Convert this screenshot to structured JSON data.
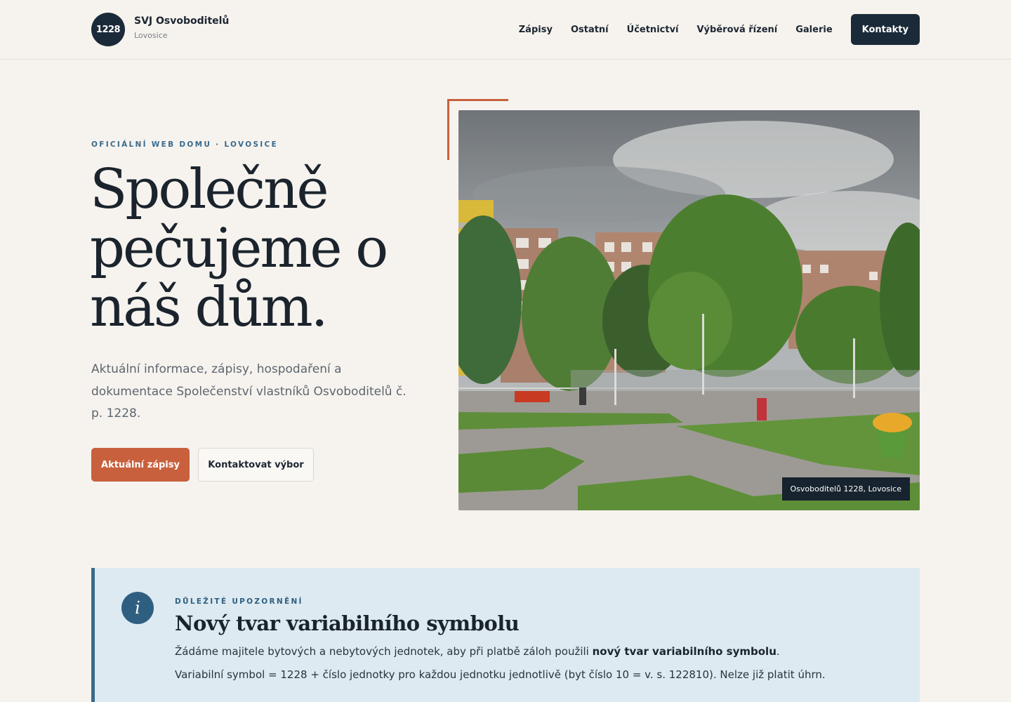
{
  "header": {
    "logo_number": "1228",
    "brand_name": "SVJ Osvoboditelů",
    "brand_sub": "Lovosice",
    "nav": [
      {
        "label": "Zápisy"
      },
      {
        "label": "Ostatní"
      },
      {
        "label": "Účetnictví"
      },
      {
        "label": "Výběrová řízení"
      },
      {
        "label": "Galerie"
      }
    ],
    "cta_label": "Kontakty"
  },
  "hero": {
    "eyebrow": "OFICIÁLNÍ WEB DOMU · LOVOSICE",
    "title": "Společně pečujeme o náš dům.",
    "lead": "Aktuální informace, zápisy, hospodaření a dokumentace Společenství vlastníků Osvoboditelů č. p. 1228.",
    "primary_button": "Aktuální zápisy",
    "secondary_button": "Kontaktovat výbor",
    "photo_caption": "Osvoboditelů 1228, Lovosice"
  },
  "notice": {
    "icon_glyph": "i",
    "eyebrow": "DŮLEŽITÉ UPOZORNĚNÍ",
    "title": "Nový tvar variabilního symbolu",
    "p1_before": "Žádáme majitele bytových a nebytových jednotek, aby při platbě záloh použili ",
    "p1_bold": "nový tvar variabilního symbolu",
    "p1_after": ".",
    "p2": "Variabilní symbol = 1228 + číslo jednotky pro každou jednotku jednotlivě (byt číslo 10 = v. s. 122810). Nelze již platit úhrn."
  },
  "colors": {
    "background": "#f6f3ee",
    "navy": "#1b2a39",
    "accent": "#c8603e",
    "notice_bg": "#ddeaf2",
    "notice_accent": "#3a6a8c"
  }
}
